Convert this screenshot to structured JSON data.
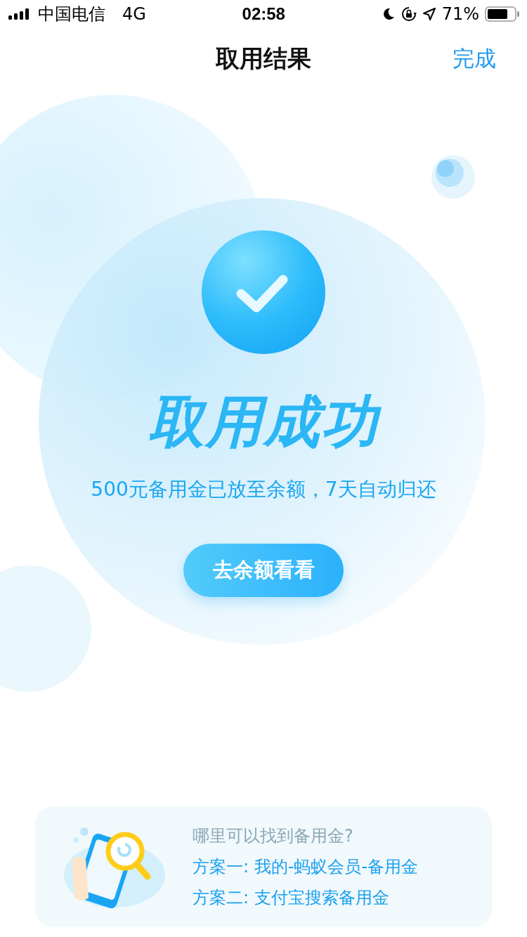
{
  "status_bar": {
    "carrier": "中国电信",
    "network": "4G",
    "time": "02:58",
    "battery": "71%"
  },
  "nav": {
    "title": "取用结果",
    "action": "完成"
  },
  "result": {
    "headline": "取用成功",
    "message": "500元备用金已放至余额，7天自动归还",
    "button": "去余额看看"
  },
  "tip_card": {
    "title": "哪里可以找到备用金?",
    "lines": [
      "方案一: 我的-蚂蚁会员-备用金",
      "方案二: 支付宝搜索备用金"
    ]
  }
}
